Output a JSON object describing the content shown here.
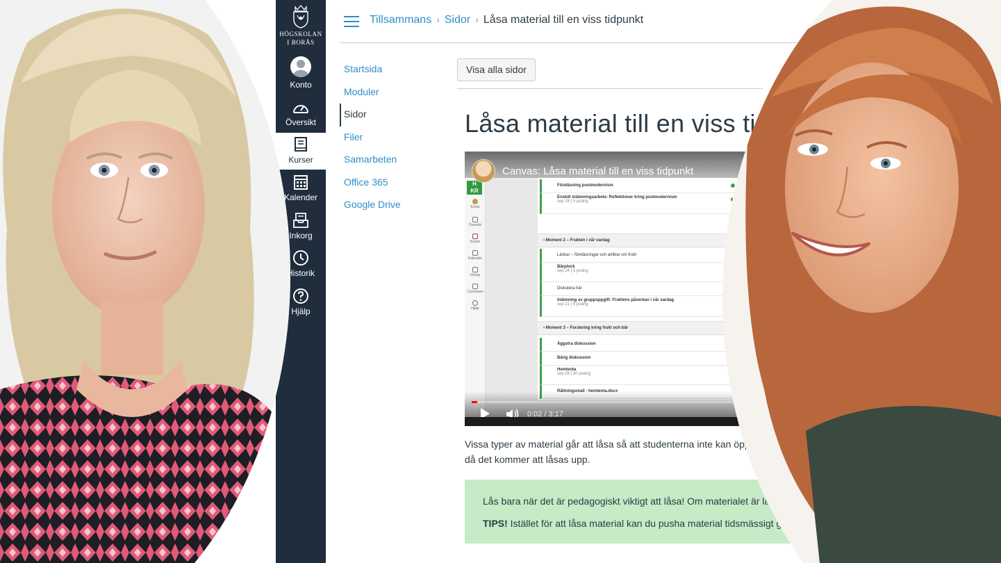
{
  "institution": {
    "line1": "HÖGSKOLAN",
    "line2": "I BORÅS"
  },
  "global_nav": [
    {
      "id": "konto",
      "label": "Konto",
      "icon": "account-icon"
    },
    {
      "id": "oversikt",
      "label": "Översikt",
      "icon": "dashboard-icon"
    },
    {
      "id": "kurser",
      "label": "Kurser",
      "icon": "courses-icon"
    },
    {
      "id": "kalender",
      "label": "Kalender",
      "icon": "calendar-icon"
    },
    {
      "id": "inkorg",
      "label": "Inkorg",
      "icon": "inbox-icon"
    },
    {
      "id": "historik",
      "label": "Historik",
      "icon": "history-icon"
    },
    {
      "id": "hjalp",
      "label": "Hjälp",
      "icon": "help-icon"
    }
  ],
  "breadcrumb": [
    "Tillsammans",
    "Sidor",
    "Låsa material till en viss tidpunkt"
  ],
  "course_nav": [
    "Startsida",
    "Moduler",
    "Sidor",
    "Filer",
    "Samarbeten",
    "Office 365",
    "Google Drive"
  ],
  "course_nav_active": "Sidor",
  "content": {
    "view_all_button": "Visa alla sidor",
    "page_title": "Låsa material till en viss tidp",
    "body_line1": "Vissa typer av material går att låsa så att studenterna inte kan öppna",
    "body_line2": "då det kommer att låsas upp.",
    "tip_line1": "Lås bara när det är pedagogiskt viktigt att låsa! Om materialet är låst b",
    "tip_label": "TIPS!",
    "tip_line2": " Istället för att låsa material kan du pusha material tidsmässigt geno"
  },
  "video": {
    "title": "Canvas: Låsa material till en viss tidpunkt",
    "time_current": "0:02",
    "time_total": "3:17",
    "progress": 0.01,
    "sidebar": [
      "Konto",
      "Översikt",
      "Kurser",
      "Kalender",
      "Inkorg",
      "Commons",
      "Hjälp"
    ],
    "list": {
      "rows_top": [
        {
          "title": "Föreläsning postmodernism",
          "meta": ""
        },
        {
          "title": "Enskilt inlämningsarbete: Reflektioner kring postmodernism",
          "meta": "sep 24 | 5 poäng"
        }
      ],
      "module2": "Moment 2 – Frukten i vår vardag",
      "rows_m2": [
        {
          "title": "Länkar – föreläsningar och artiklar om frukt",
          "meta": ""
        },
        {
          "title": "Bärplock",
          "meta": "sep 24 | 5 poäng"
        },
        {
          "title": "Diskutera här",
          "meta": ""
        },
        {
          "title": "Inlämning av gruppuppgift: Fruktens påverkan i vår vardag",
          "meta": "sep 21 | 5 poäng"
        }
      ],
      "module3": "Moment 3 – Forskning kring frukt och bär",
      "rows_m3": [
        {
          "title": "Äggstra diskussion",
          "meta": ""
        },
        {
          "title": "Bärig diskussion",
          "meta": ""
        },
        {
          "title": "Hemtenta",
          "meta": "sep 26 | 30 poäng"
        },
        {
          "title": "Rättningsmall - hemtenta.docx",
          "meta": ""
        }
      ]
    }
  },
  "colors": {
    "nav_bg": "#1f2d3d",
    "link": "#2d8fc8",
    "text": "#2d3b45",
    "tip_bg": "#c6ebc6",
    "module_check": "#3aa34a"
  }
}
